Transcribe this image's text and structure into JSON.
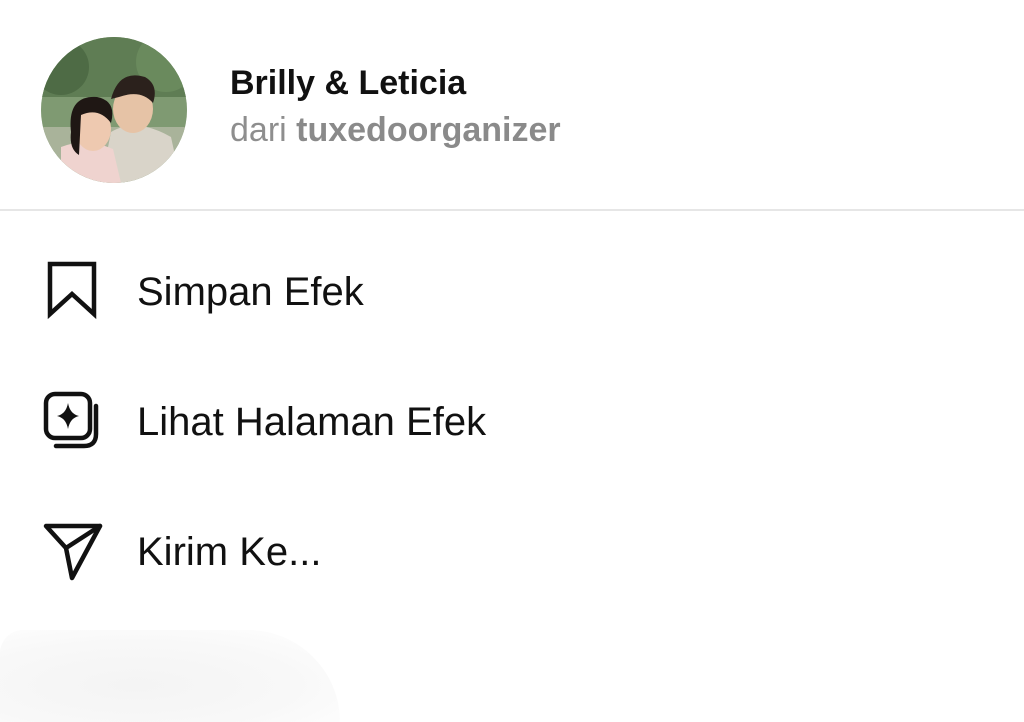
{
  "effect": {
    "name": "Brilly & Leticia",
    "by_prefix": "dari ",
    "author": "tuxedoorganizer",
    "avatar_icon": "couple-photo-avatar"
  },
  "menu": [
    {
      "id": "save",
      "label": "Simpan Efek",
      "icon": "bookmark-icon"
    },
    {
      "id": "view",
      "label": "Lihat Halaman Efek",
      "icon": "effect-gallery-icon"
    },
    {
      "id": "send",
      "label": "Kirim Ke...",
      "icon": "paper-plane-icon"
    }
  ],
  "colors": {
    "background": "#ffffff",
    "text": "#111111",
    "secondary_text": "#8e8e8e",
    "divider": "#e6e6e6"
  }
}
